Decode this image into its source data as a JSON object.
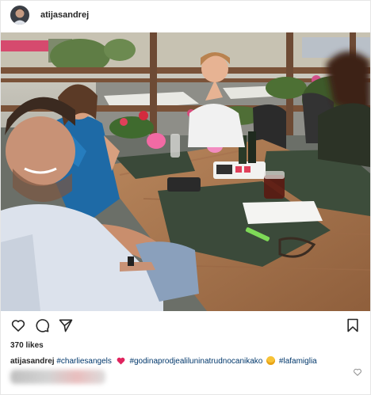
{
  "post": {
    "username": "atijasandrej",
    "likes": "370 likes",
    "caption": {
      "username": "atijasandrej",
      "tag1": "#charliesangels",
      "tag2": "#godinaprodjealilunin",
      "tag2b": "atrudnocanikako",
      "tag3": "#lafamiglia"
    }
  },
  "icons": [
    "heart-icon",
    "comment-icon",
    "share-icon",
    "bookmark-icon"
  ],
  "colors": {
    "tag": "#00376b",
    "heart": "#ed4956",
    "border": "#e6e6e6"
  }
}
